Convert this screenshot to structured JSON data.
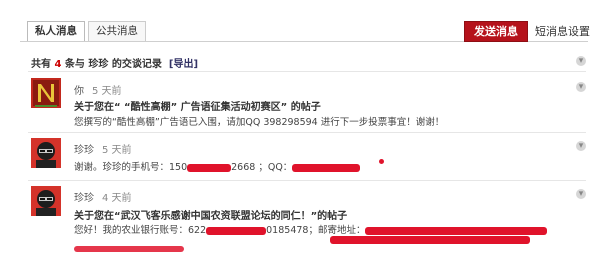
{
  "tabs": [
    {
      "label": "私人消息",
      "active": true
    },
    {
      "label": "公共消息",
      "active": false
    }
  ],
  "actions": {
    "send_label": "发送消息",
    "settings_label": "短消息设置"
  },
  "summary": {
    "prefix": "共有 ",
    "count": "4",
    "middle": " 条与 ",
    "user": "珍珍",
    "suffix": " 的交谈记录",
    "export_label": "[导出]"
  },
  "messages": [
    {
      "sender": "你",
      "time": "5 天前",
      "title": "关于您在“ “酷性高棚” 广告语征集活动初赛区” 的帖子",
      "body": "您撰写的“酷性高棚”广告语已入围，请加QQ 398298594 进行下一步投票事宜！谢谢！"
    },
    {
      "sender": "珍珍",
      "time": "5 天前",
      "body_parts": [
        "谢谢。珍珍的手机号：150",
        "2668 ；QQ："
      ]
    },
    {
      "sender": "珍珍",
      "time": "4 天前",
      "title": "关于您在“武汉飞客乐感谢中国农资联盟论坛的同仁！”的帖子",
      "body_parts": [
        "您好！我的农业银行账号：622",
        "0185478；邮寄地址："
      ],
      "body_line2": ""
    }
  ],
  "colors": {
    "accent": "#b5121b",
    "redact": "#e0132b"
  }
}
